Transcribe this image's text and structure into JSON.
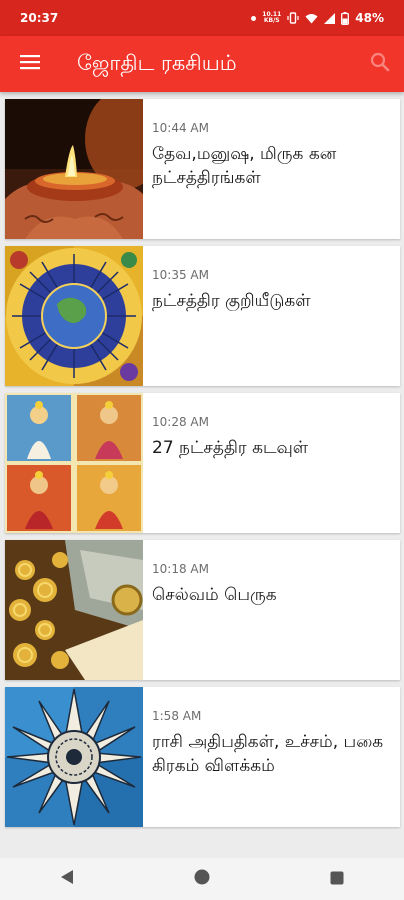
{
  "status_bar": {
    "time": "20:37",
    "network_line1": "10.11",
    "network_line2": "KB/S",
    "battery": "48%"
  },
  "app_bar": {
    "title": "ஜோதிட ரகசியம்",
    "menu_icon": "hamburger-menu-icon",
    "search_icon": "search-icon"
  },
  "articles": [
    {
      "time": "10:44 AM",
      "title": "தேவ,மனுஷ, மிருக கன நட்சத்திரங்கள்",
      "thumbnail": "oil-lamp-diya"
    },
    {
      "time": "10:35 AM",
      "title": "நட்சத்திர குறியீடுகள்",
      "thumbnail": "zodiac-wheel"
    },
    {
      "time": "10:28 AM",
      "title": "27 நட்சத்திர கடவுள்",
      "thumbnail": "goddess-collage"
    },
    {
      "time": "10:18 AM",
      "title": "செல்வம் பெருக",
      "thumbnail": "gold-and-money"
    },
    {
      "time": "1:58 AM",
      "title": "ராசி அதிபதிகள், உச்சம், பகை கிரகம் விளக்கம்",
      "thumbnail": "sun-mandala"
    }
  ],
  "colors": {
    "status_bar": "#d7261e",
    "app_bar": "#f2352b",
    "background": "#ececec"
  },
  "nav_bar": {
    "back_icon": "back-triangle-icon",
    "home_icon": "home-circle-icon",
    "recents_icon": "recents-square-icon"
  }
}
